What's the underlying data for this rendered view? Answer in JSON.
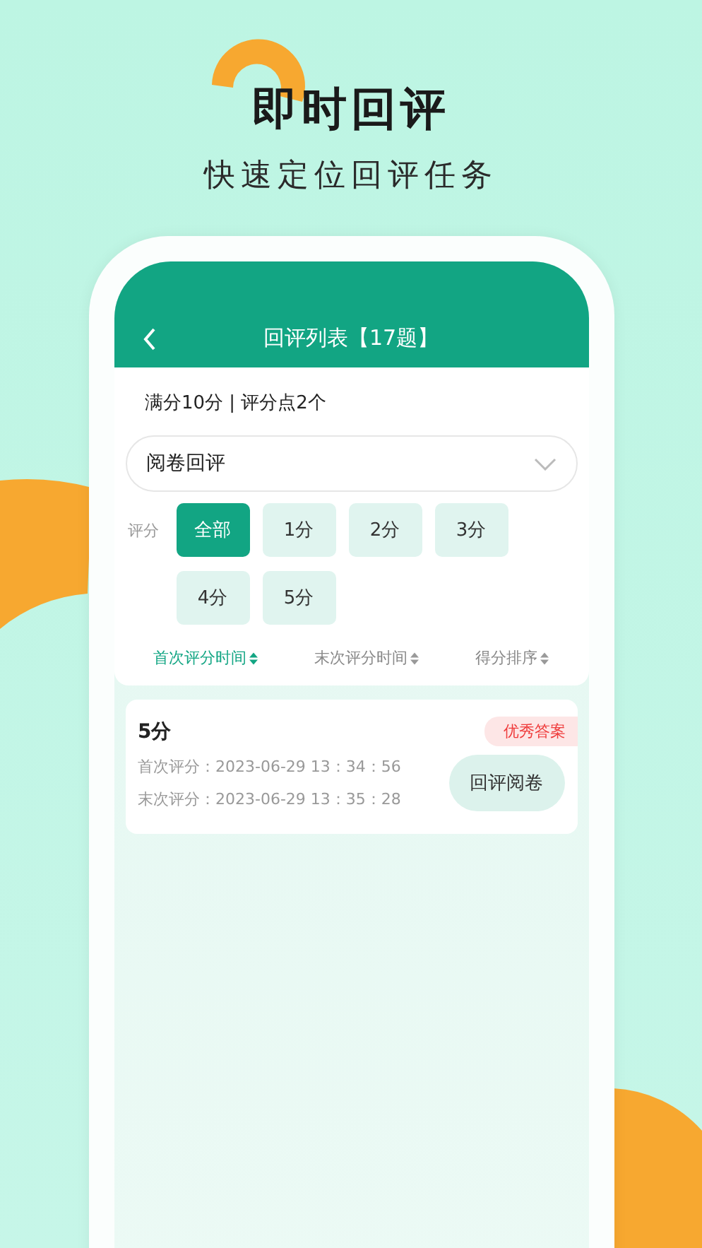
{
  "headline": "即时回评",
  "subheadline": "快速定位回评任务",
  "screen": {
    "title": "回评列表【17题】",
    "summary": "满分10分 | 评分点2个",
    "dropdown": {
      "value": "阅卷回评"
    },
    "score_filter": {
      "label": "评分",
      "options": [
        {
          "label": "全部",
          "selected": true
        },
        {
          "label": "1分",
          "selected": false
        },
        {
          "label": "2分",
          "selected": false
        },
        {
          "label": "3分",
          "selected": false
        },
        {
          "label": "4分",
          "selected": false
        },
        {
          "label": "5分",
          "selected": false
        }
      ]
    },
    "sort_options": [
      {
        "label": "首次评分时间",
        "selected": true
      },
      {
        "label": "末次评分时间",
        "selected": false
      },
      {
        "label": "得分排序",
        "selected": false
      }
    ],
    "records": [
      {
        "score": "5分",
        "badge": "优秀答案",
        "first_scored": "首次评分：2023-06-29 13：34：56",
        "last_scored": "末次评分：2023-06-29 13：35：28",
        "action": "回评阅卷"
      }
    ]
  }
}
